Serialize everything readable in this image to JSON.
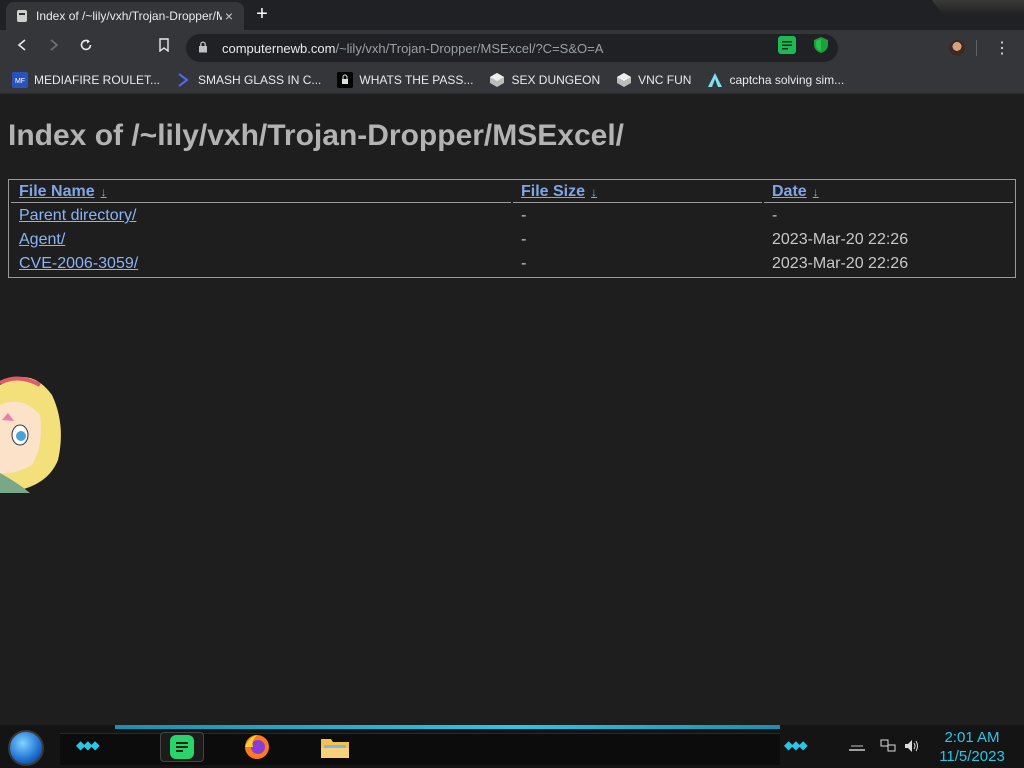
{
  "browser": {
    "tab_title": "Index of /~lily/vxh/Trojan-Dropper/MSExcel/",
    "tab_close": "×",
    "new_tab": "+",
    "url_host": "computernewb.com",
    "url_path": "/~lily/vxh/Trojan-Dropper/MSExcel/?C=S&O=A",
    "menu": "⋮"
  },
  "bookmarks": [
    {
      "label": "MEDIAFIRE ROULET...",
      "icon": "mediafire-icon"
    },
    {
      "label": "SMASH GLASS IN C...",
      "icon": "chevron-icon"
    },
    {
      "label": "WHATS THE PASS...",
      "icon": "lock-icon"
    },
    {
      "label": "SEX DUNGEON",
      "icon": "cube-icon"
    },
    {
      "label": "VNC FUN",
      "icon": "cube-icon"
    },
    {
      "label": "captcha solving sim...",
      "icon": "triangle-icon"
    }
  ],
  "page": {
    "heading": "Index of /~lily/vxh/Trojan-Dropper/MSExcel/",
    "columns": [
      {
        "label": "File Name",
        "sort": "↓"
      },
      {
        "label": "File Size",
        "sort": "↓"
      },
      {
        "label": "Date",
        "sort": "↓"
      }
    ],
    "rows": [
      {
        "name": "Parent directory/",
        "size": "-",
        "date": "-"
      },
      {
        "name": "Agent/",
        "size": "-",
        "date": "2023-Mar-20 22:26"
      },
      {
        "name": "CVE-2006-3059/",
        "size": "-",
        "date": "2023-Mar-20 22:26"
      }
    ]
  },
  "taskbar": {
    "time": "2:01 AM",
    "date": "11/5/2023",
    "apps": [
      "notes-icon",
      "firefox-icon",
      "folder-icon"
    ]
  },
  "colors": {
    "accent": "#2ac6e8",
    "link": "#8ab4f8",
    "background": "#1e1e1e"
  }
}
